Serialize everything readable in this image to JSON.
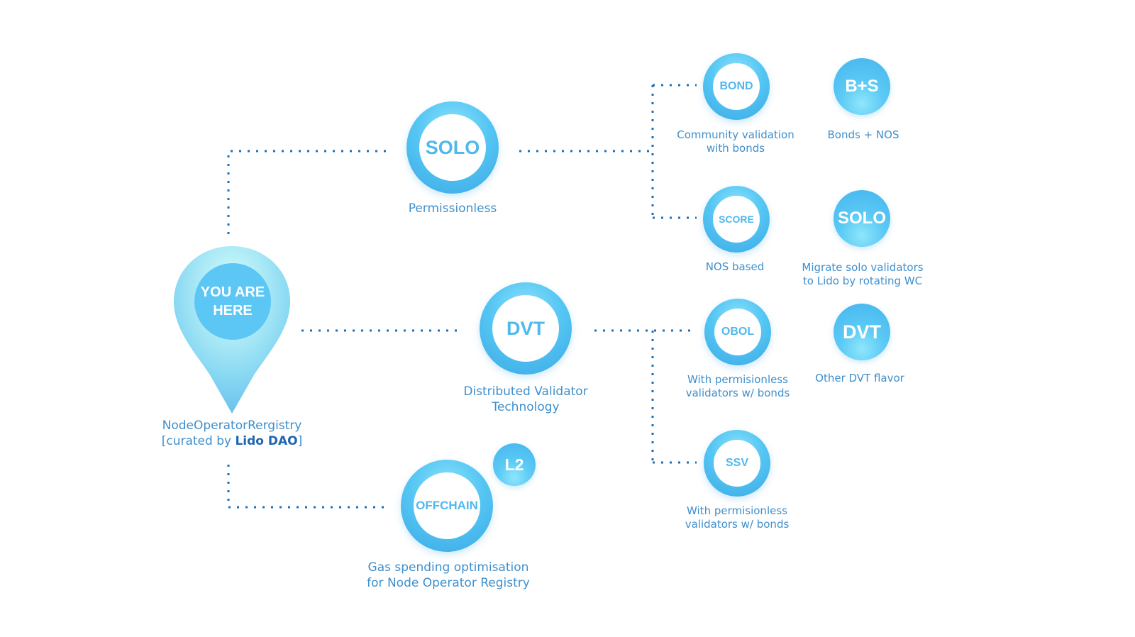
{
  "colors": {
    "connector": "#1f6fb8",
    "ring": "#4fb8ec",
    "label_text": "#3f8fcc",
    "highlight_text": "#1f66b0",
    "pin": "#5cc6f5"
  },
  "start": {
    "pin_text_line1": "YOU ARE",
    "pin_text_line2": "HERE",
    "label_line1": "NodeOperatorRergistry",
    "label_prefix": "[curated by ",
    "label_highlight": "Lido DAO",
    "label_suffix": "]"
  },
  "branches": {
    "solo": {
      "title": "SOLO",
      "label": "Permissionless"
    },
    "dvt": {
      "title": "DVT",
      "label_line1": "Distributed Validator",
      "label_line2": "Technology"
    },
    "offchain": {
      "title": "OFFCHAIN",
      "badge": "L2",
      "label_line1": "Gas spending optimisation",
      "label_line2": "for Node Operator Registry"
    }
  },
  "leaves": {
    "bond": {
      "title": "BOND",
      "label_line1": "Community validation",
      "label_line2": "with bonds"
    },
    "score": {
      "title": "SCORE",
      "label_line1": "NOS based"
    },
    "obol": {
      "title": "OBOL",
      "label_line1": "With permisionless",
      "label_line2": "validators w/ bonds"
    },
    "ssv": {
      "title": "SSV",
      "label_line1": "With permisionless",
      "label_line2": "validators w/ bonds"
    }
  },
  "extras": {
    "bs": {
      "title": "B+S",
      "label_line1": "Bonds + NOS"
    },
    "solo": {
      "title": "SOLO",
      "label_line1": "Migrate solo validators",
      "label_line2": "to Lido by rotating WC"
    },
    "dvt": {
      "title": "DVT",
      "label_line1": "Other DVT flavor"
    }
  }
}
